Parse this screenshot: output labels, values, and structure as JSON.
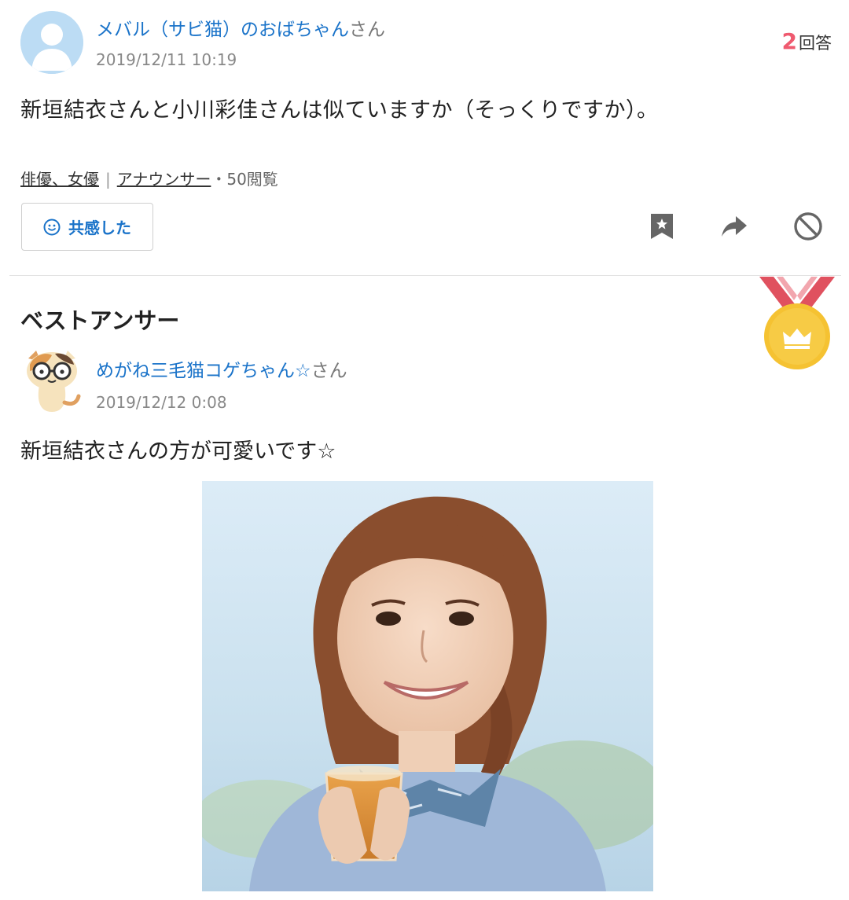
{
  "question": {
    "author_name": "メバル（サビ猫）のおばちゃん",
    "author_suffix": "さん",
    "date": "2019/12/11 10:19",
    "answer_count": "2",
    "answer_count_label": "回答",
    "text": "新垣結衣さんと小川彩佳さんは似ていますか（そっくりですか）。",
    "categories": [
      "俳優、女優",
      "アナウンサー"
    ],
    "views": "・50閲覧",
    "empathy_button": "共感した"
  },
  "best_answer": {
    "section_title": "ベストアンサー",
    "author_name": "めがね三毛猫コゲちゃん☆",
    "author_suffix": "さん",
    "date": "2019/12/12 0:08",
    "text": "新垣結衣さんの方が可愛いです☆"
  },
  "colors": {
    "link_blue": "#1a73c9",
    "count_red": "#ef5a6f",
    "medal_gold": "#f5c232",
    "ribbon_red": "#e0515f"
  }
}
